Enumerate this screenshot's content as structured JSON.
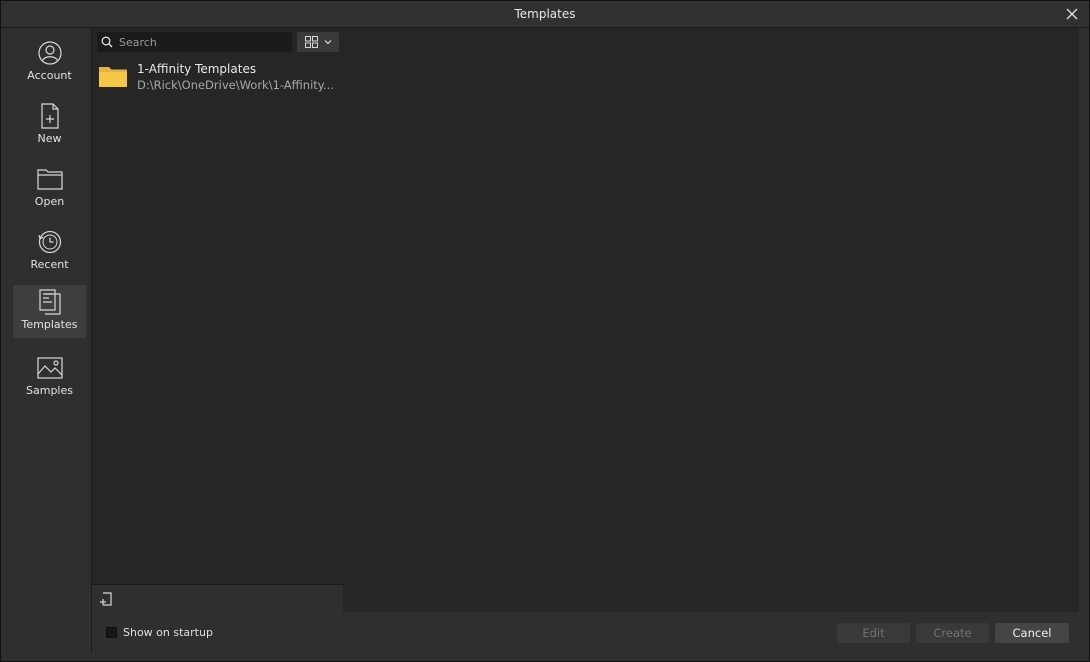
{
  "window": {
    "title": "Templates"
  },
  "sidebar": {
    "items": [
      {
        "label": "Account",
        "icon": "account-icon",
        "active": false
      },
      {
        "label": "New",
        "icon": "new-document-icon",
        "active": false
      },
      {
        "label": "Open",
        "icon": "folder-open-icon",
        "active": false
      },
      {
        "label": "Recent",
        "icon": "recent-clock-icon",
        "active": false
      },
      {
        "label": "Templates",
        "icon": "templates-icon",
        "active": true
      },
      {
        "label": "Samples",
        "icon": "samples-image-icon",
        "active": false
      }
    ]
  },
  "search": {
    "placeholder": "Search",
    "value": ""
  },
  "templates": [
    {
      "name": "1-Affinity Templates",
      "path": "D:\\Rick\\OneDrive\\Work\\1-Affinity..."
    }
  ],
  "footer": {
    "show_on_startup_label": "Show on startup",
    "show_on_startup_checked": false,
    "edit_label": "Edit",
    "create_label": "Create",
    "cancel_label": "Cancel"
  },
  "colors": {
    "folder": "#f5c84a",
    "panel": "#262626",
    "chrome": "#2f2f2f"
  }
}
